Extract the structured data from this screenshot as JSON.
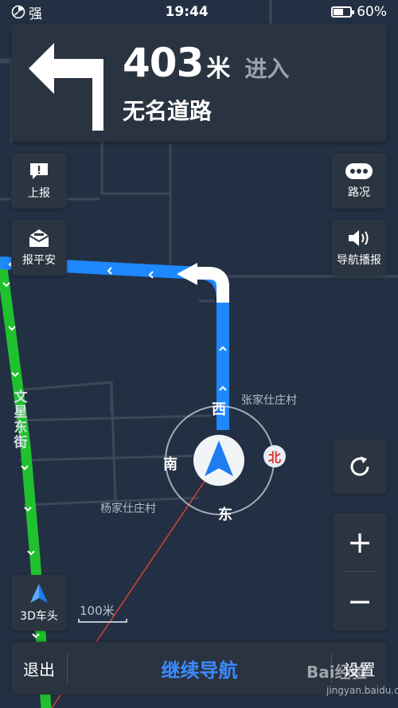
{
  "status_bar": {
    "signal_label": "强",
    "time": "19:44",
    "battery_percent_text": "60%",
    "battery_level": 0.6
  },
  "guidance": {
    "turn_icon": "turn-left-arrow-icon",
    "distance_value": "403",
    "distance_unit": "米",
    "action": "进入",
    "road_name": "无名道路"
  },
  "left_buttons": [
    {
      "label": "上报",
      "icon": "report-icon"
    },
    {
      "label": "报平安",
      "icon": "safe-message-icon"
    }
  ],
  "right_buttons": [
    {
      "label": "路况",
      "icon": "traffic-dots-icon"
    },
    {
      "label": "导航播报",
      "icon": "speaker-icon"
    }
  ],
  "map": {
    "poi_1": "张家仕庄村",
    "poi_2": "杨家仕庄村",
    "street_name": "文星东街",
    "compass": {
      "west": "西",
      "south": "南",
      "east": "东",
      "north": "北"
    },
    "scale_label": "100米"
  },
  "controls": {
    "view_mode_label": "3D车头",
    "refresh_icon": "refresh-icon",
    "zoom_in_label": "+",
    "zoom_out_label": "−"
  },
  "bottom_bar": {
    "exit_label": "退出",
    "continue_label": "继续导航",
    "settings_label": "设置"
  },
  "watermark": {
    "main": "Bai经验",
    "sub": "jingyan.baidu.com"
  },
  "colors": {
    "map_bg": "#233044",
    "route_blue": "#1e88ff",
    "route_green": "#1fc22e",
    "accent_blue": "#3b8bff",
    "north_red": "#d9322b"
  }
}
